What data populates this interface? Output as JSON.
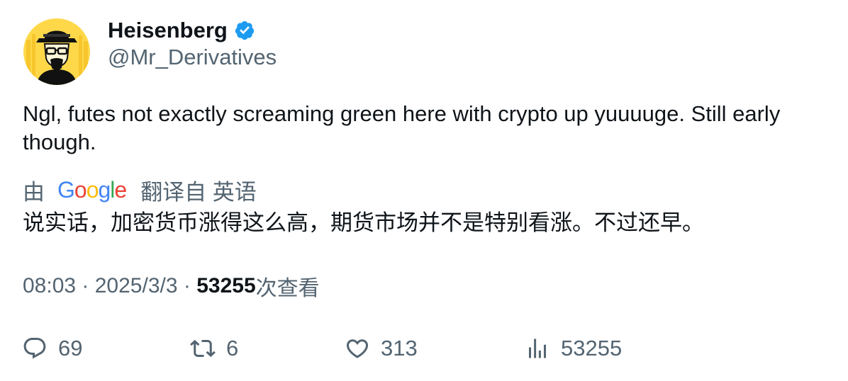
{
  "author": {
    "display_name": "Heisenberg",
    "handle": "@Mr_Derivatives",
    "verified": true,
    "avatar_icon": "heisenberg-avatar-icon"
  },
  "tweet": {
    "text": "Ngl, futes not exactly screaming green here with crypto up yuuuuge. Still early though."
  },
  "translation": {
    "prefix": "由",
    "provider": "Google",
    "suffix": "翻译自 英语",
    "text": "说实话，加密货币涨得这么高，期货市场并不是特别看涨。不过还早。"
  },
  "meta": {
    "time": "08:03",
    "separator": " · ",
    "date": "2025/3/3",
    "views_count": "53255",
    "views_label": "次查看"
  },
  "actions": {
    "replies": "69",
    "retweets": "6",
    "likes": "313",
    "views": "53255"
  },
  "colors": {
    "text_primary": "#0f1419",
    "text_secondary": "#536471",
    "verified_blue": "#1d9bf0",
    "avatar_yellow": "#ffd84a",
    "google_blue": "#4285f4",
    "google_red": "#ea4335",
    "google_yellow": "#fbbc05",
    "google_green": "#34a853"
  }
}
